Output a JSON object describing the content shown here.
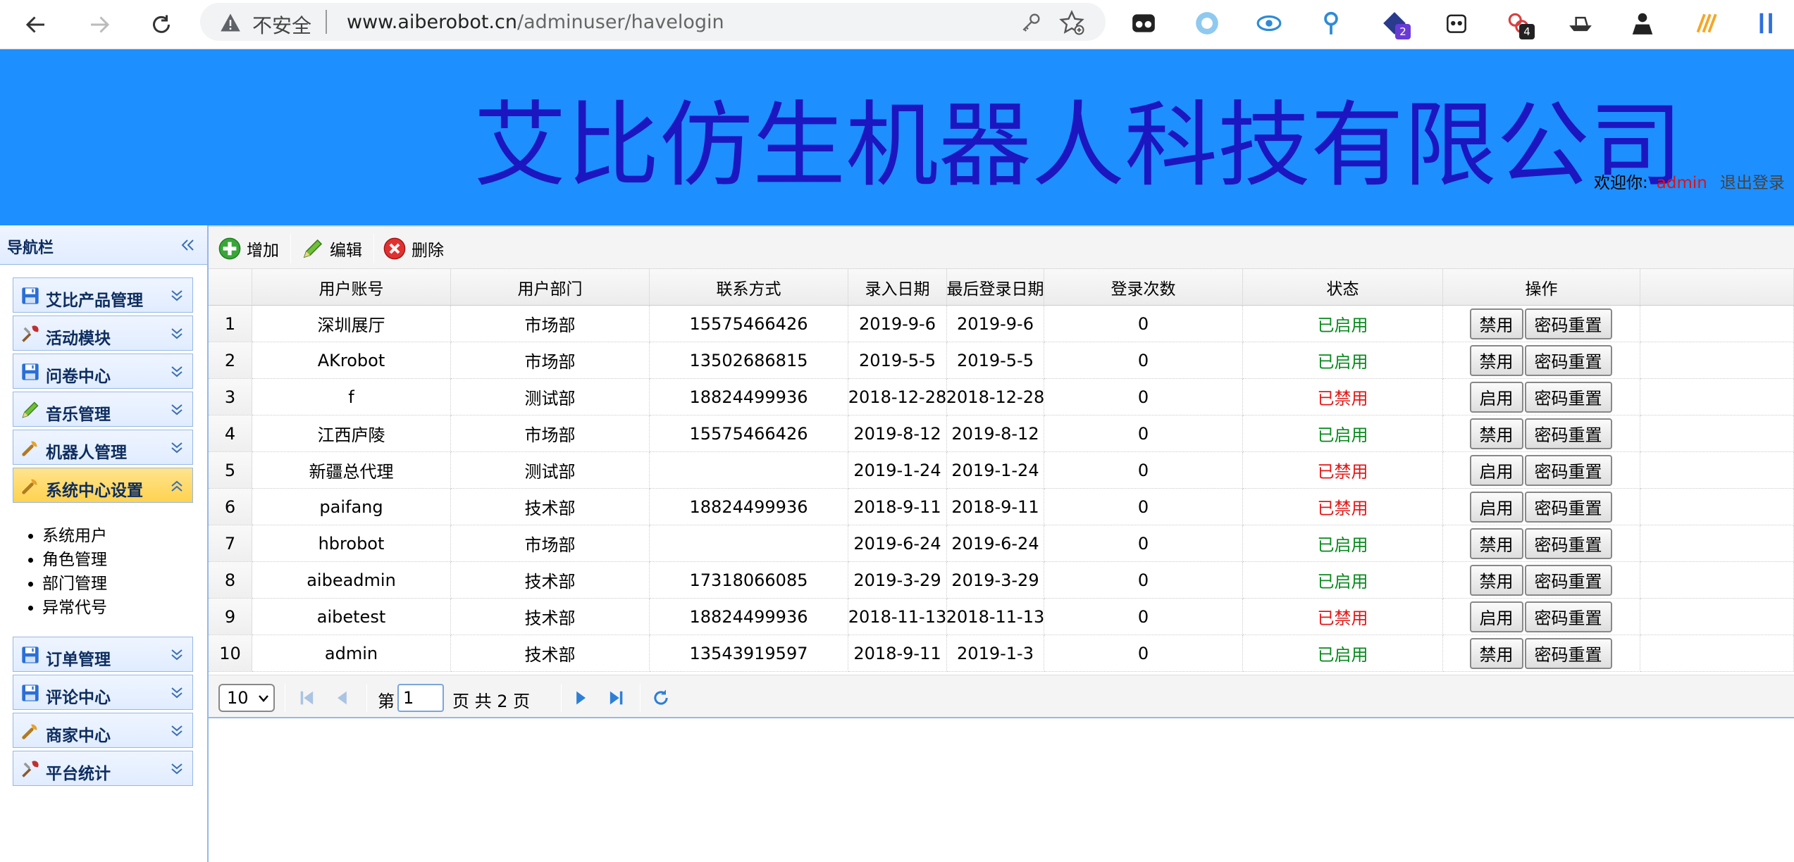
{
  "browser": {
    "insecure_label": "不安全",
    "url_host": "www.aiberobot.cn",
    "url_path": "/adminuser/havelogin",
    "extensions": [
      {
        "name": "glasses-ext-icon",
        "badge": ""
      },
      {
        "name": "circle-ext-icon",
        "badge": ""
      },
      {
        "name": "eye-ext-icon",
        "badge": ""
      },
      {
        "name": "pin-ext-icon",
        "badge": ""
      },
      {
        "name": "cube-ext-icon",
        "badge": "2"
      },
      {
        "name": "panda-ext-icon",
        "badge": ""
      },
      {
        "name": "puzzle-ext-icon",
        "badge": "4"
      },
      {
        "name": "ship-ext-icon",
        "badge": ""
      },
      {
        "name": "person-ext-icon",
        "badge": ""
      },
      {
        "name": "slashes-ext-icon",
        "badge": ""
      },
      {
        "name": "bars-ext-icon",
        "badge": ""
      }
    ]
  },
  "header": {
    "company": "艾比仿生机器人科技有限公司",
    "welcome_label": "欢迎你:",
    "username": "admin",
    "logout": "退出登录"
  },
  "sidebar": {
    "title": "导航栏",
    "menus": [
      {
        "label": "艾比产品管理",
        "icon": "floppy-icon",
        "active": false
      },
      {
        "label": "活动模块",
        "icon": "tools-icon",
        "active": false
      },
      {
        "label": "问卷中心",
        "icon": "floppy-icon",
        "active": false
      },
      {
        "label": "音乐管理",
        "icon": "pencil-icon",
        "active": false
      },
      {
        "label": "机器人管理",
        "icon": "wrench-icon",
        "active": false
      },
      {
        "label": "系统中心设置",
        "icon": "wrench-icon",
        "active": true
      },
      {
        "label": "订单管理",
        "icon": "floppy-icon",
        "active": false
      },
      {
        "label": "评论中心",
        "icon": "floppy-icon",
        "active": false
      },
      {
        "label": "商家中心",
        "icon": "wrench-icon",
        "active": false
      },
      {
        "label": "平台统计",
        "icon": "tools-icon",
        "active": false
      }
    ],
    "submenu": [
      "系统用户",
      "角色管理",
      "部门管理",
      "异常代号"
    ]
  },
  "toolbar": {
    "add": "增加",
    "edit": "编辑",
    "delete": "删除"
  },
  "table": {
    "columns": [
      "用户账号",
      "用户部门",
      "联系方式",
      "录入日期",
      "最后登录日期",
      "登录次数",
      "状态",
      "操作"
    ],
    "rows": [
      {
        "n": "1",
        "account": "深圳展厅",
        "dept": "市场部",
        "phone": "15575466426",
        "created": "2019-9-6",
        "last": "2019-9-6",
        "count": "0",
        "status": "已启用",
        "enabled": true,
        "toggle": "禁用",
        "reset": "密码重置"
      },
      {
        "n": "2",
        "account": "AKrobot",
        "dept": "市场部",
        "phone": "13502686815",
        "created": "2019-5-5",
        "last": "2019-5-5",
        "count": "0",
        "status": "已启用",
        "enabled": true,
        "toggle": "禁用",
        "reset": "密码重置"
      },
      {
        "n": "3",
        "account": "f",
        "dept": "测试部",
        "phone": "18824499936",
        "created": "2018-12-28",
        "last": "2018-12-28",
        "count": "0",
        "status": "已禁用",
        "enabled": false,
        "toggle": "启用",
        "reset": "密码重置"
      },
      {
        "n": "4",
        "account": "江西庐陵",
        "dept": "市场部",
        "phone": "15575466426",
        "created": "2019-8-12",
        "last": "2019-8-12",
        "count": "0",
        "status": "已启用",
        "enabled": true,
        "toggle": "禁用",
        "reset": "密码重置"
      },
      {
        "n": "5",
        "account": "新疆总代理",
        "dept": "测试部",
        "phone": "",
        "created": "2019-1-24",
        "last": "2019-1-24",
        "count": "0",
        "status": "已禁用",
        "enabled": false,
        "toggle": "启用",
        "reset": "密码重置"
      },
      {
        "n": "6",
        "account": "paifang",
        "dept": "技术部",
        "phone": "18824499936",
        "created": "2018-9-11",
        "last": "2018-9-11",
        "count": "0",
        "status": "已禁用",
        "enabled": false,
        "toggle": "启用",
        "reset": "密码重置"
      },
      {
        "n": "7",
        "account": "hbrobot",
        "dept": "市场部",
        "phone": "",
        "created": "2019-6-24",
        "last": "2019-6-24",
        "count": "0",
        "status": "已启用",
        "enabled": true,
        "toggle": "禁用",
        "reset": "密码重置"
      },
      {
        "n": "8",
        "account": "aibeadmin",
        "dept": "技术部",
        "phone": "17318066085",
        "created": "2019-3-29",
        "last": "2019-3-29",
        "count": "0",
        "status": "已启用",
        "enabled": true,
        "toggle": "禁用",
        "reset": "密码重置"
      },
      {
        "n": "9",
        "account": "aibetest",
        "dept": "技术部",
        "phone": "18824499936",
        "created": "2018-11-13",
        "last": "2018-11-13",
        "count": "0",
        "status": "已禁用",
        "enabled": false,
        "toggle": "启用",
        "reset": "密码重置"
      },
      {
        "n": "10",
        "account": "admin",
        "dept": "技术部",
        "phone": "13543919597",
        "created": "2018-9-11",
        "last": "2019-1-3",
        "count": "0",
        "status": "已启用",
        "enabled": true,
        "toggle": "禁用",
        "reset": "密码重置"
      }
    ]
  },
  "pager": {
    "page_size": "10",
    "page_prefix": "第",
    "current_page": "1",
    "page_suffix": "页 共 2 页"
  },
  "colors": {
    "header_bg": "#1e8fff",
    "company_text": "#1c16c0",
    "enabled": "#0a8a1f",
    "disabled": "#e01818",
    "accent_active": "#ffd24f"
  }
}
